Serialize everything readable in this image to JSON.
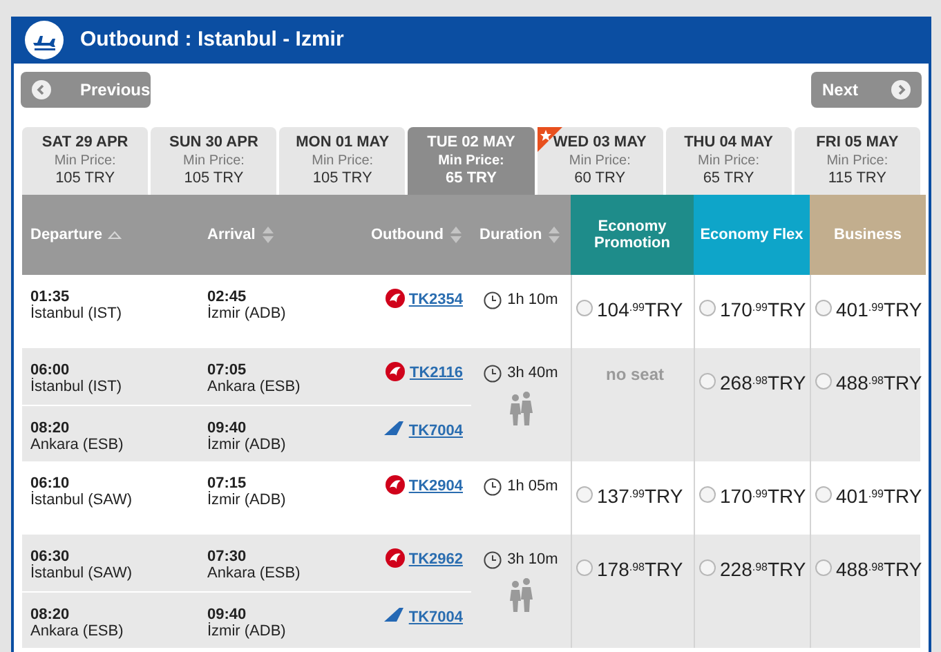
{
  "title": "Outbound : Istanbul - Izmir",
  "nav": {
    "previous": "Previous",
    "next": "Next"
  },
  "dates": [
    {
      "day": "SAT 29 APR",
      "label": "Min Price:",
      "price": "105 TRY",
      "selected": false,
      "featured": false
    },
    {
      "day": "SUN 30 APR",
      "label": "Min Price:",
      "price": "105 TRY",
      "selected": false,
      "featured": false
    },
    {
      "day": "MON 01 MAY",
      "label": "Min Price:",
      "price": "105 TRY",
      "selected": false,
      "featured": false
    },
    {
      "day": "TUE 02 MAY",
      "label": "Min Price:",
      "price": "65 TRY",
      "selected": true,
      "featured": false
    },
    {
      "day": "WED 03 MAY",
      "label": "Min Price:",
      "price": "60 TRY",
      "selected": false,
      "featured": true
    },
    {
      "day": "THU 04 MAY",
      "label": "Min Price:",
      "price": "65 TRY",
      "selected": false,
      "featured": false
    },
    {
      "day": "FRI 05 MAY",
      "label": "Min Price:",
      "price": "115 TRY",
      "selected": false,
      "featured": false
    }
  ],
  "columns": [
    {
      "label": "Departure",
      "sorted": true
    },
    {
      "label": "Arrival",
      "sorted": false
    },
    {
      "label": "Outbound",
      "sorted": false
    },
    {
      "label": "Duration",
      "sorted": false
    }
  ],
  "cabins": [
    {
      "label": "Economy Promotion",
      "color": "#1e8c8a"
    },
    {
      "label": "Economy Flex",
      "color": "#0ea5c9"
    },
    {
      "label": "Business",
      "color": "#c2ae8e"
    }
  ],
  "flights": [
    {
      "segments": [
        {
          "dep_time": "01:35",
          "dep_place": "İstanbul (IST)",
          "arr_time": "02:45",
          "arr_place": "İzmir (ADB)",
          "kind": "turkish",
          "flight": "TK2354"
        }
      ],
      "duration": "1h 10m",
      "transfer": false,
      "fares": [
        {
          "kind": "price",
          "text": "104$^{.99}$TRY",
          "selected": false
        },
        {
          "kind": "price",
          "text": "170$^{.99}$TRY",
          "selected": false
        },
        {
          "kind": "price",
          "text": "401$^{.99}$TRY",
          "selected": false
        }
      ]
    },
    {
      "segments": [
        {
          "dep_time": "06:00",
          "dep_place": "İstanbul (IST)",
          "arr_time": "07:05",
          "arr_place": "Ankara (ESB)",
          "kind": "turkish",
          "flight": "TK2116"
        },
        {
          "dep_time": "08:20",
          "dep_place": "Ankara (ESB)",
          "arr_time": "09:40",
          "arr_place": "İzmir (ADB)",
          "kind": "anadolu",
          "flight": "TK7004"
        }
      ],
      "duration": "3h 40m",
      "transfer": true,
      "fares": [
        {
          "kind": "none",
          "text": "no seat"
        },
        {
          "kind": "price",
          "text": "268$^{.98}$TRY",
          "selected": false
        },
        {
          "kind": "price",
          "text": "488$^{.98}$TRY",
          "selected": false
        }
      ]
    },
    {
      "segments": [
        {
          "dep_time": "06:10",
          "dep_place": "İstanbul (SAW)",
          "arr_time": "07:15",
          "arr_place": "İzmir (ADB)",
          "kind": "turkish",
          "flight": "TK2904"
        }
      ],
      "duration": "1h 05m",
      "transfer": false,
      "fares": [
        {
          "kind": "price",
          "text": "137$^{.99}$TRY",
          "selected": false
        },
        {
          "kind": "price",
          "text": "170$^{.99}$TRY",
          "selected": false
        },
        {
          "kind": "price",
          "text": "401$^{.99}$TRY",
          "selected": false
        }
      ]
    },
    {
      "segments": [
        {
          "dep_time": "06:30",
          "dep_place": "İstanbul (SAW)",
          "arr_time": "07:30",
          "arr_place": "Ankara (ESB)",
          "kind": "turkish",
          "flight": "TK2962"
        },
        {
          "dep_time": "08:20",
          "dep_place": "Ankara (ESB)",
          "arr_time": "09:40",
          "arr_place": "İzmir (ADB)",
          "kind": "anadolu",
          "flight": "TK7004"
        }
      ],
      "duration": "3h 10m",
      "transfer": true,
      "fares": [
        {
          "kind": "price",
          "text": "178$^{.98}$TRY",
          "selected": false
        },
        {
          "kind": "price",
          "text": "228$^{.98}$TRY",
          "selected": false
        },
        {
          "kind": "price",
          "text": "488$^{.98}$TRY",
          "selected": false
        }
      ]
    }
  ]
}
